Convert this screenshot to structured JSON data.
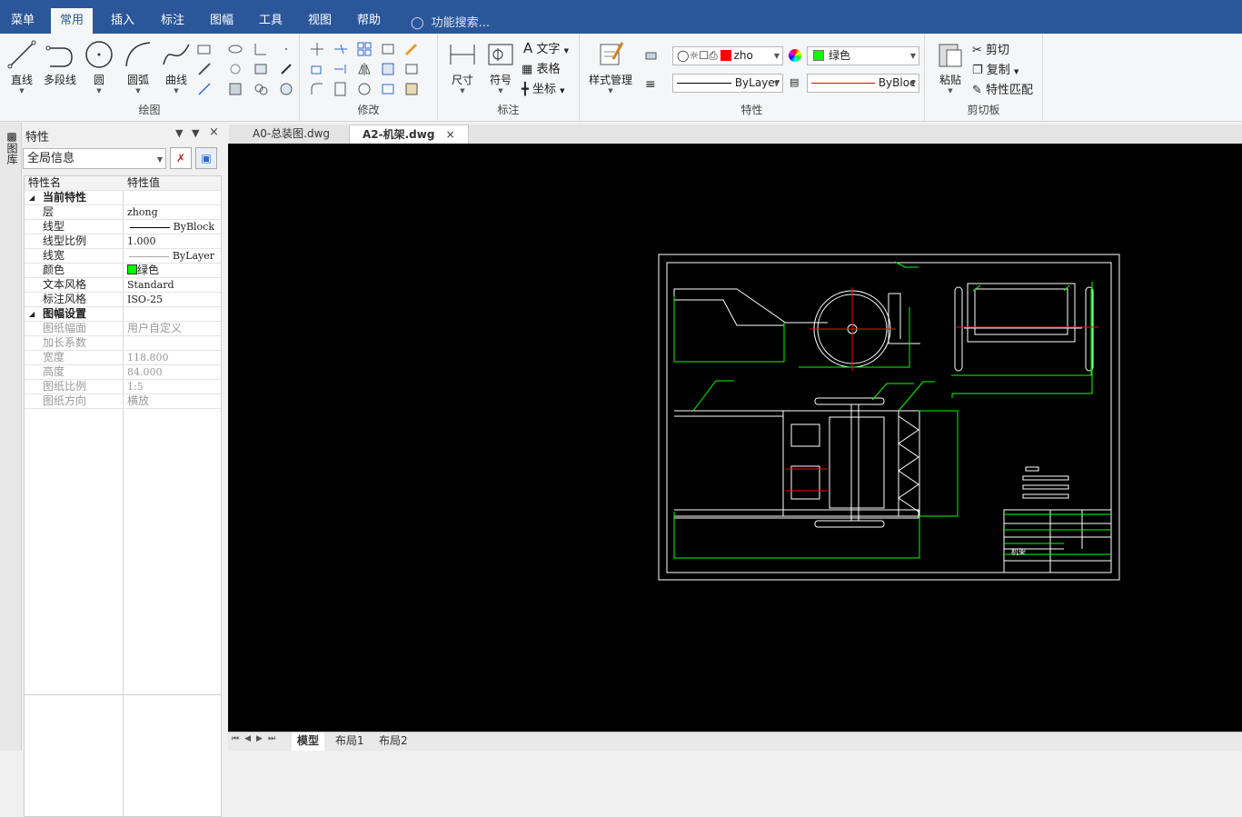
{
  "menubar": {
    "items": [
      "菜单",
      "常用",
      "插入",
      "标注",
      "图幅",
      "工具",
      "视图",
      "帮助"
    ],
    "active": "常用",
    "search_placeholder": "功能搜索..."
  },
  "ribbon": {
    "draw": {
      "label": "绘图",
      "line": "直线",
      "polyline": "多段线",
      "circle": "圆",
      "arc": "圆弧",
      "curve": "曲线"
    },
    "modify": {
      "label": "修改"
    },
    "annotate": {
      "label": "标注",
      "dimension": "尺寸",
      "symbol": "符号",
      "text": "文字",
      "table": "表格",
      "coordinate": "坐标"
    },
    "properties": {
      "label": "特性",
      "style_manager": "样式管理",
      "layer_name": "zho",
      "color": "绿色",
      "linetype": "ByLayer",
      "lineweight": "ByBloc",
      "green": "#00ff00",
      "red": "#ff0000"
    },
    "clipboard": {
      "label": "剪切板",
      "paste": "粘贴",
      "cut": "剪切",
      "copy": "复制",
      "match": "特性匹配"
    }
  },
  "panel": {
    "title": "特性",
    "side_label": "图库",
    "selector": "全局信息",
    "header_name": "特性名",
    "header_value": "特性值",
    "section_current": "当前特性",
    "section_sheet": "图幅设置",
    "current": [
      {
        "name": "层",
        "value": "zhong"
      },
      {
        "name": "线型",
        "value": "ByBlock"
      },
      {
        "name": "线型比例",
        "value": "1.000"
      },
      {
        "name": "线宽",
        "value": "ByLayer"
      },
      {
        "name": "颜色",
        "value": "绿色"
      },
      {
        "name": "文本风格",
        "value": "Standard"
      },
      {
        "name": "标注风格",
        "value": "ISO-25"
      }
    ],
    "sheet": [
      {
        "name": "图纸幅面",
        "value": "用户自定义"
      },
      {
        "name": "加长系数",
        "value": ""
      },
      {
        "name": "宽度",
        "value": "118.800"
      },
      {
        "name": "高度",
        "value": "84.000"
      },
      {
        "name": "图纸比例",
        "value": "1:5"
      },
      {
        "name": "图纸方向",
        "value": "横放"
      }
    ]
  },
  "documents": {
    "tabs": [
      "A0-总装图.dwg",
      "A2-机架.dwg"
    ],
    "active": "A2-机架.dwg"
  },
  "layouts": {
    "tabs": [
      "模型",
      "布局1",
      "布局2"
    ],
    "active": "模型"
  },
  "drawing": {
    "title_block_text": "机架"
  }
}
